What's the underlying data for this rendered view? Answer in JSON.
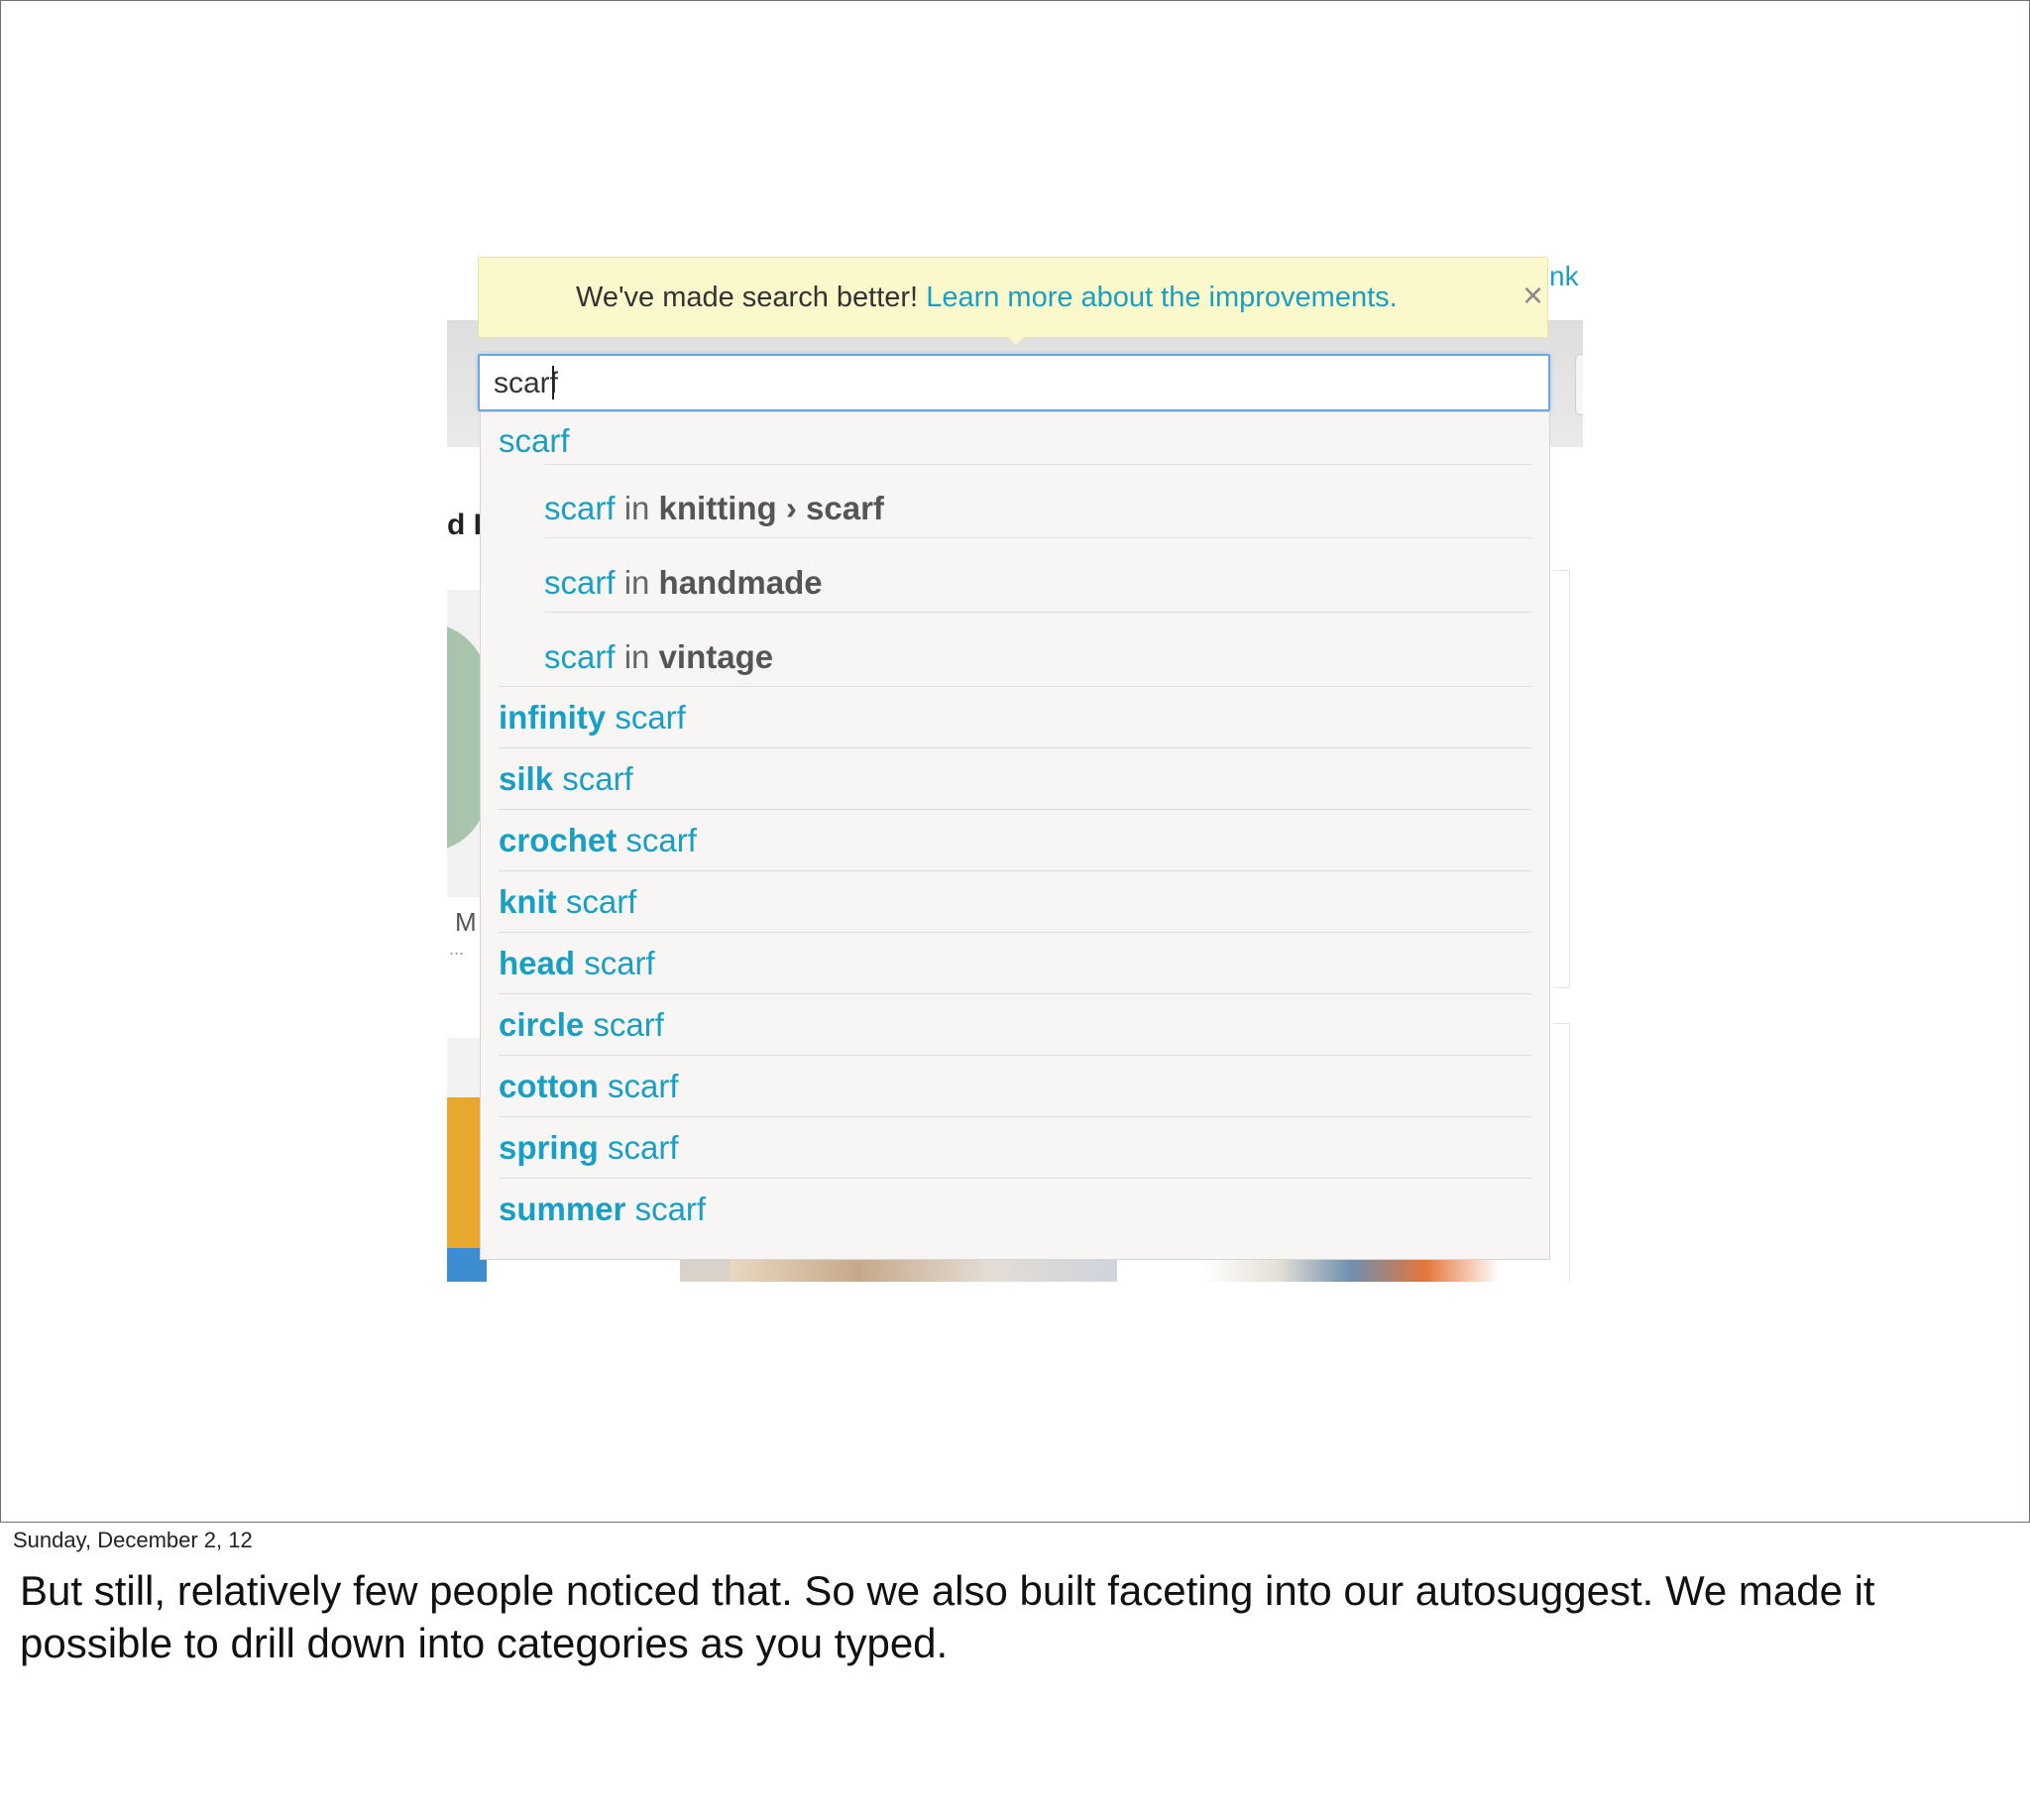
{
  "background": {
    "corner_link_fragment": "nk",
    "heading_fragment": "d I",
    "shop_fragment": "M",
    "ellipsis": "..."
  },
  "notice": {
    "text": "We've made search better!",
    "link": "Learn more about the improvements.",
    "close_glyph": "×"
  },
  "search": {
    "value": "scarf"
  },
  "suggestions": {
    "top": "scarf",
    "facets": [
      {
        "query": "scarf",
        "in": "in",
        "category": "knitting › scarf"
      },
      {
        "query": "scarf",
        "in": "in",
        "category": "handmade"
      },
      {
        "query": "scarf",
        "in": "in",
        "category": "vintage"
      }
    ],
    "items": [
      {
        "prefix": "infinity",
        "term": "scarf"
      },
      {
        "prefix": "silk",
        "term": "scarf"
      },
      {
        "prefix": "crochet",
        "term": "scarf"
      },
      {
        "prefix": "knit",
        "term": "scarf"
      },
      {
        "prefix": "head",
        "term": "scarf"
      },
      {
        "prefix": "circle",
        "term": "scarf"
      },
      {
        "prefix": "cotton",
        "term": "scarf"
      },
      {
        "prefix": "spring",
        "term": "scarf"
      },
      {
        "prefix": "summer",
        "term": "scarf"
      }
    ]
  },
  "slide_date": "Sunday, December 2, 12",
  "speaker_notes": "But still, relatively few people noticed that. So we also built faceting into our autosuggest. We made it possible to drill down into categories as you typed.",
  "colors": {
    "link": "#1a9fc4",
    "notice_bg": "#fbf9cc",
    "input_focus": "#6ea8db"
  }
}
